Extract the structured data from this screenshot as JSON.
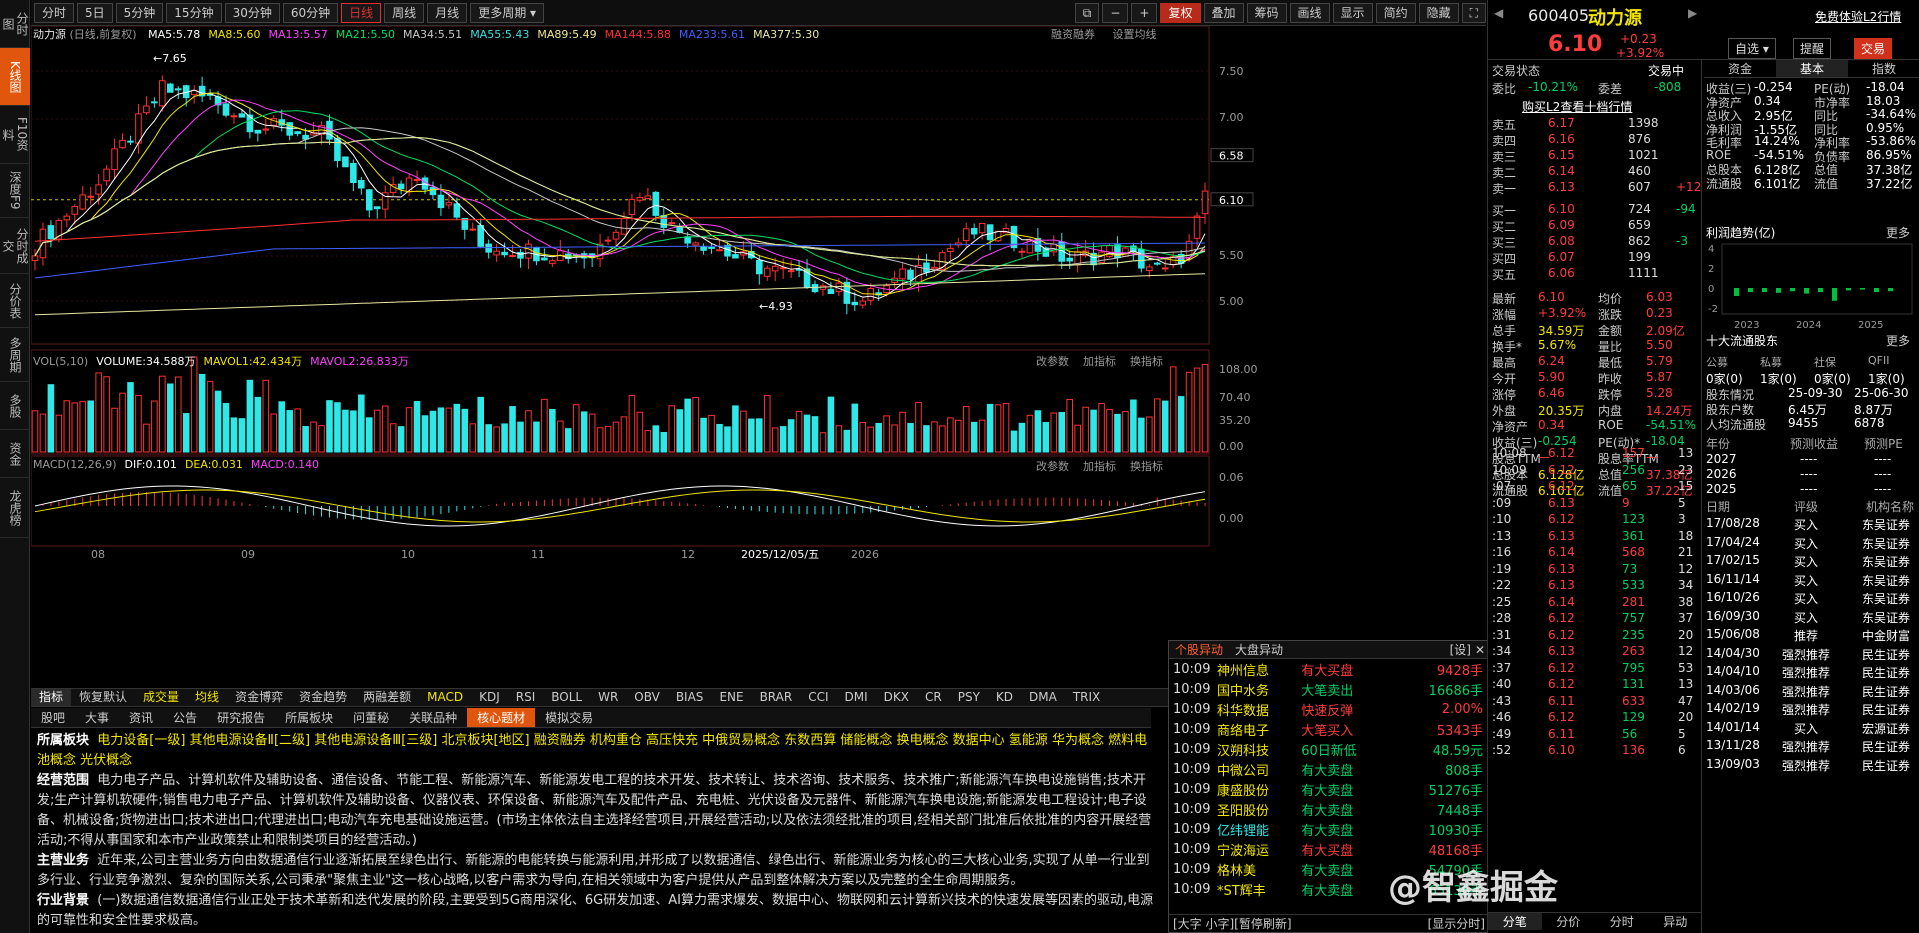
{
  "sidebar": {
    "items": [
      "分时图",
      "K线图",
      "F10资料",
      "深度F9",
      "分时成交",
      "分价表",
      "多周期",
      "多股",
      "资金",
      "龙虎榜"
    ],
    "active_index": 1
  },
  "toolbar": {
    "periods": [
      "分时",
      "5日",
      "5分钟",
      "15分钟",
      "30分钟",
      "60分钟",
      "日线",
      "周线",
      "月线",
      "更多周期"
    ],
    "selected_period": "日线",
    "right_buttons": [
      "复权",
      "叠加",
      "筹码",
      "画线",
      "显示",
      "简约",
      "隐藏"
    ]
  },
  "kline": {
    "title": "动力源",
    "mode": "(日线,前复权)",
    "ma": [
      {
        "label": "MA5:5.78",
        "color": "#ffffff"
      },
      {
        "label": "MA8:5.60",
        "color": "#f2e600"
      },
      {
        "label": "MA13:5.57",
        "color": "#ff40ff"
      },
      {
        "label": "MA21:5.50",
        "color": "#00e060"
      },
      {
        "label": "MA34:5.51",
        "color": "#c8c8c8"
      },
      {
        "label": "MA55:5.43",
        "color": "#3ce0e0"
      },
      {
        "label": "MA89:5.49",
        "color": "#f0e68c"
      },
      {
        "label": "MA144:5.88",
        "color": "#ff3030"
      },
      {
        "label": "MA233:5.61",
        "color": "#4060ff"
      },
      {
        "label": "MA377:5.30",
        "color": "#e8e8a0"
      }
    ],
    "right_labels": [
      "融资融券",
      "设置均线"
    ],
    "y_ticks": [
      "7.50",
      "7.00",
      "6.58",
      "6.10",
      "5.50",
      "5.00"
    ],
    "high_label": "7.65",
    "low_label": "4.93"
  },
  "volume": {
    "labels": [
      "VOL(5,10)",
      "VOLUME:34.588万",
      "MAVOL1:42.434万",
      "MAVOL2:26.833万"
    ],
    "y_ticks": [
      "108.00",
      "70.40",
      "35.20",
      "0.00"
    ],
    "controls": [
      "改参数",
      "加指标",
      "换指标"
    ]
  },
  "macd": {
    "labels": [
      "MACD(12,26,9)",
      "DIF:0.101",
      "DEA:0.031",
      "MACD:0.140"
    ],
    "y_ticks": [
      "0.06",
      "0.00"
    ],
    "controls": [
      "改参数",
      "加指标",
      "换指标"
    ]
  },
  "xaxis": {
    "labels": [
      "08",
      "09",
      "10",
      "11",
      "12",
      "2025/12/05/五",
      "2026"
    ]
  },
  "indicator_tabs": [
    "指标",
    "恢复默认",
    "成交量",
    "均线",
    "资金博弈",
    "资金趋势",
    "两融差额",
    "MACD",
    "KDJ",
    "RSI",
    "BOLL",
    "WR",
    "OBV",
    "BIAS",
    "ENE",
    "BRAR",
    "CCI",
    "DMI",
    "DKX",
    "CR",
    "PSY",
    "KD",
    "DMA",
    "TRIX"
  ],
  "info_tabs": [
    "股吧",
    "大事",
    "资讯",
    "公告",
    "研究报告",
    "所属板块",
    "问董秘",
    "关联品种",
    "核心题材",
    "模拟交易"
  ],
  "info_selected": "核心题材",
  "info": {
    "sector_label": "所属板块",
    "sectors": "电力设备[一级] 其他电源设备Ⅱ[二级] 其他电源设备Ⅲ[三级] 北京板块[地区] 融资融券 机构重仓 高压快充 中俄贸易概念 东数西算 储能概念 换电概念 数据中心 氢能源 华为概念 燃料电池概念 光伏概念",
    "scope_label": "经营范围",
    "scope": "电力电子产品、计算机软件及辅助设备、通信设备、节能工程、新能源汽车、新能源发电工程的技术开发、技术转让、技术咨询、技术服务、技术推广;新能源汽车换电设施销售;技术开发;生产计算机软硬件;销售电力电子产品、计算机软件及辅助设备、仪器仪表、环保设备、新能源汽车及配件产品、充电桩、光伏设备及元器件、新能源汽车换电设施;新能源发电工程设计;电子设备、机械设备;货物进出口;技术进出口;代理进出口;电动汽车充电基础设施运营。(市场主体依法自主选择经营项目,开展经营活动;以及依法须经批准的项目,经相关部门批准后依批准的内容开展经营活动;不得从事国家和本市产业政策禁止和限制类项目的经营活动。)",
    "biz_label": "主营业务",
    "biz": "近年来,公司主营业务方向由数据通信行业逐渐拓展至绿色出行、新能源的电能转换与能源利用,并形成了以数据通信、绿色出行、新能源业务为核心的三大核心业务,实现了从单一行业到多行业、行业竞争激烈、复杂的国际关系,公司秉承\"聚焦主业\"这一核心战略,以客户需求为导向,在相关领域中为客户提供从产品到整体解决方案以及完整的全生命周期服务。",
    "bg_label": "行业背景",
    "bg": "(一)数据通信数据通信行业正处于技术革新和迭代发展的阶段,主要受到5G商用深化、6G研发加速、AI算力需求爆发、数据中心、物联网和云计算新兴技术的快速发展等因素的驱动,电源的可靠性和安全性要求极高。"
  },
  "popup": {
    "tabs": [
      "个股异动",
      "大盘异动"
    ],
    "settings": "[设]",
    "rows": [
      [
        "10:09",
        "神州信息",
        "有大买盘",
        "9428手",
        "buy"
      ],
      [
        "10:09",
        "国中水务",
        "大笔卖出",
        "16686手",
        "sell"
      ],
      [
        "10:09",
        "科华数据",
        "快速反弹",
        "2.00%",
        "buy"
      ],
      [
        "10:09",
        "商络电子",
        "大笔买入",
        "5343手",
        "buy"
      ],
      [
        "10:09",
        "汉朔科技",
        "60日新低",
        "48.59元",
        "sell"
      ],
      [
        "10:09",
        "中微公司",
        "有大卖盘",
        "808手",
        "sell"
      ],
      [
        "10:09",
        "康盛股份",
        "有大卖盘",
        "51276手",
        "sell"
      ],
      [
        "10:09",
        "圣阳股份",
        "有大卖盘",
        "7448手",
        "sell"
      ],
      [
        "10:09",
        "亿纬锂能",
        "有大卖盘",
        "10930手",
        "sell"
      ],
      [
        "10:09",
        "宁波海运",
        "有大买盘",
        "48168手",
        "buy"
      ],
      [
        "10:09",
        "格林美",
        "有大卖盘",
        "54790手",
        "sell"
      ],
      [
        "10:09",
        "*ST辉丰",
        "有大卖盘",
        "65136手",
        "sell"
      ]
    ],
    "footer_left": "[大字 小字][暂停刷新]",
    "footer_right": "[显示分时]"
  },
  "quote": {
    "code": "600405",
    "name": "动力源",
    "price": "6.10",
    "change": "+0.23",
    "pct": "+3.92%",
    "trial": "免费体验L2行情",
    "buttons": [
      "自选",
      "提醒",
      "交易"
    ],
    "status_label": "交易状态",
    "status": "交易中",
    "webi_label": "委比",
    "webi": "-10.21%",
    "weicha_label": "委差",
    "weicha": "-808",
    "l2_link": "购买L2查看十档行情",
    "sells": [
      [
        "卖五",
        "6.17",
        "1398",
        ""
      ],
      [
        "卖四",
        "6.16",
        "876",
        ""
      ],
      [
        "卖三",
        "6.15",
        "1021",
        ""
      ],
      [
        "卖二",
        "6.14",
        "460",
        ""
      ],
      [
        "卖一",
        "6.13",
        "607",
        "+12"
      ]
    ],
    "buys": [
      [
        "买一",
        "6.10",
        "724",
        "-94"
      ],
      [
        "买二",
        "6.09",
        "659",
        ""
      ],
      [
        "买三",
        "6.08",
        "862",
        "-3"
      ],
      [
        "买四",
        "6.07",
        "199",
        ""
      ],
      [
        "买五",
        "6.06",
        "1111",
        ""
      ]
    ],
    "stats": [
      [
        "最新",
        "6.10",
        "均价",
        "6.03"
      ],
      [
        "涨幅",
        "+3.92%",
        "涨跌",
        "0.23"
      ],
      [
        "总手",
        "34.59万",
        "金额",
        "2.09亿"
      ],
      [
        "换手*",
        "5.67%",
        "量比",
        "5.50"
      ],
      [
        "最高",
        "6.24",
        "最低",
        "5.79"
      ],
      [
        "今开",
        "5.90",
        "昨收",
        "5.87"
      ],
      [
        "涨停",
        "6.46",
        "跌停",
        "5.28"
      ],
      [
        "外盘",
        "20.35万",
        "内盘",
        "14.24万"
      ],
      [
        "净资产",
        "0.34",
        "ROE",
        "-54.51%"
      ],
      [
        "收益(三)",
        "-0.254",
        "PE(动)*",
        "-18.04"
      ],
      [
        "股息TTM",
        "—",
        "股息率TTM",
        "—"
      ],
      [
        "总股本",
        "6.128亿",
        "总值",
        "37.38亿"
      ],
      [
        "流通股",
        "6.101亿",
        "流值",
        "37.22亿"
      ]
    ],
    "ticks": [
      [
        "10:08",
        "6.12",
        "157",
        "13"
      ],
      [
        "10:09",
        "6.12",
        "256",
        "23"
      ],
      [
        ":07",
        "6.12",
        "65",
        "15"
      ],
      [
        ":09",
        "6.13",
        "9",
        "5"
      ],
      [
        ":10",
        "6.12",
        "123",
        "3"
      ],
      [
        ":13",
        "6.13",
        "361",
        "18"
      ],
      [
        ":16",
        "6.14",
        "568",
        "21"
      ],
      [
        ":19",
        "6.13",
        "73",
        "12"
      ],
      [
        ":22",
        "6.13",
        "533",
        "34"
      ],
      [
        ":25",
        "6.14",
        "281",
        "38"
      ],
      [
        ":28",
        "6.12",
        "757",
        "37"
      ],
      [
        ":31",
        "6.12",
        "235",
        "20"
      ],
      [
        ":34",
        "6.13",
        "263",
        "12"
      ],
      [
        ":37",
        "6.12",
        "795",
        "53"
      ],
      [
        ":40",
        "6.12",
        "131",
        "13"
      ],
      [
        ":43",
        "6.11",
        "633",
        "47"
      ],
      [
        ":46",
        "6.12",
        "129",
        "20"
      ],
      [
        ":49",
        "6.11",
        "56",
        "5"
      ],
      [
        ":52",
        "6.10",
        "136",
        "6"
      ]
    ],
    "tick_tabs": [
      "分笔",
      "分价",
      "分时",
      "异动"
    ]
  },
  "fund": {
    "tabs": [
      "资金",
      "基本",
      "指数"
    ],
    "selected": "基本",
    "rows": [
      [
        "收益(三)",
        "-0.254",
        "PE(动)",
        "-18.04"
      ],
      [
        "净资产",
        "0.34",
        "市净率",
        "18.03"
      ],
      [
        "总收入",
        "2.95亿",
        "同比",
        "-34.64%"
      ],
      [
        "净利润",
        "-1.55亿",
        "同比",
        "0.95%"
      ],
      [
        "毛利率",
        "14.24%",
        "净利率",
        "-53.86%"
      ],
      [
        "ROE",
        "-54.51%",
        "负债率",
        "86.95%"
      ],
      [
        "总股本",
        "6.128亿",
        "总值",
        "37.38亿"
      ],
      [
        "流通股",
        "6.101亿",
        "流值",
        "37.22亿"
      ]
    ],
    "profit_title": "利润趋势(亿)",
    "more": "更多",
    "profit_ticks": [
      "4",
      "2",
      "0",
      "-2"
    ],
    "profit_years": [
      "2023",
      "2024",
      "2025"
    ],
    "holders_title": "十大流通股东",
    "holder_cols": [
      "公募",
      "私募",
      "社保",
      "QFII"
    ],
    "holder_vals": [
      "0家(0)",
      "1家(0)",
      "0家(0)",
      "1家(0)"
    ],
    "holder_rows": [
      [
        "股东情况",
        "25-09-30",
        "25-06-30"
      ],
      [
        "股东户数",
        "6.45万",
        "8.87万"
      ],
      [
        "人均流通股",
        "9455",
        "6878"
      ]
    ],
    "forecast_cols": [
      "年份",
      "预测收益",
      "预测PE"
    ],
    "forecast_rows": [
      [
        "2027",
        "----",
        "----"
      ],
      [
        "2026",
        "----",
        "----"
      ],
      [
        "2025",
        "----",
        "----"
      ]
    ],
    "rating_cols": [
      "日期",
      "评级",
      "机构名称"
    ],
    "rating_rows": [
      [
        "17/08/28",
        "买入",
        "东吴证券"
      ],
      [
        "17/04/24",
        "买入",
        "东吴证券"
      ],
      [
        "17/02/15",
        "买入",
        "东吴证券"
      ],
      [
        "16/11/14",
        "买入",
        "东吴证券"
      ],
      [
        "16/10/26",
        "买入",
        "东吴证券"
      ],
      [
        "16/09/30",
        "买入",
        "东吴证券"
      ],
      [
        "15/06/08",
        "推荐",
        "中金财富"
      ],
      [
        "14/04/30",
        "强烈推荐",
        "民生证券"
      ],
      [
        "14/04/10",
        "强烈推荐",
        "民生证券"
      ],
      [
        "14/03/06",
        "强烈推荐",
        "民生证券"
      ],
      [
        "14/02/19",
        "强烈推荐",
        "民生证券"
      ],
      [
        "14/01/14",
        "买入",
        "宏源证券"
      ],
      [
        "13/11/28",
        "强烈推荐",
        "民生证券"
      ],
      [
        "13/09/03",
        "强烈推荐",
        "民生证券"
      ]
    ],
    "watermark": "@智鑫掘金"
  }
}
